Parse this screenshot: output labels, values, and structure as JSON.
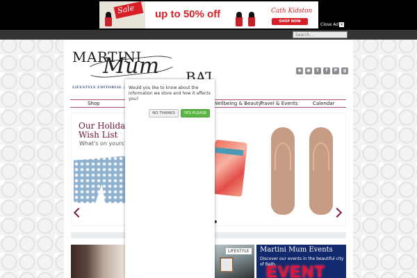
{
  "ad": {
    "sale_label": "Sale",
    "headline": "up to 50% off",
    "brand": "Cath Kidston",
    "cta": "SHOP NOW",
    "close_label": "Close Ad",
    "close_glyph": "×"
  },
  "search": {
    "placeholder": "Search..."
  },
  "logo": {
    "line1": "MARTINI",
    "line2": "Mum",
    "line3": "BATH"
  },
  "tagline": "LIFESTYLE EDITORIAL | EVENTS",
  "social_icons": [
    "rss-icon",
    "instagram-icon",
    "twitter-icon",
    "facebook-icon",
    "pinterest-icon",
    "google-plus-icon"
  ],
  "nav": {
    "items": [
      "Shop",
      "Wellbeing & Beauty",
      "Travel & Events",
      "Calendar"
    ]
  },
  "slider": {
    "title_line1": "Our Holiday",
    "title_line2": "Wish List",
    "subtitle": "What's on yours?"
  },
  "bottom": {
    "lifestyle_label": "LIFESTYLE",
    "events_title": "Martini Mum Events",
    "events_desc": "Discover our events in the beautiful city of Bath.",
    "events_sign": "EVENT"
  },
  "cookie_popup": {
    "message": "Would you like to know about the information we store and how it affects you?",
    "no_label": "NO THANKS",
    "yes_label": "YES PLEASE"
  },
  "colors": {
    "accent": "#6b1532",
    "nav_border": "#b94b63",
    "yes_button": "#5bb543",
    "events_bg": "#122a6d"
  }
}
